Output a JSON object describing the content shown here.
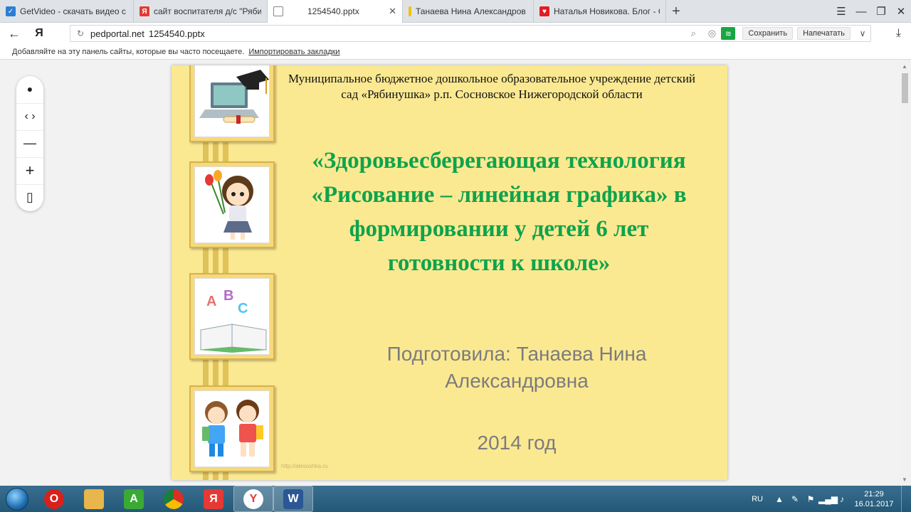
{
  "browser": {
    "tabs": [
      {
        "label": "GetVideo - скачать видео с",
        "color": "#2a7fd4",
        "glyph": "✓"
      },
      {
        "label": "сайт воспитателя д/с \"Рябин",
        "color": "#e53935",
        "glyph": "Я"
      },
      {
        "label": "1254540.pptx",
        "color": "#ffffff",
        "glyph": ""
      },
      {
        "label": "Танаева Нина Александров",
        "color": "#f3c200",
        "glyph": "ı"
      },
      {
        "label": "Наталья Новикова. Блог - С",
        "color": "#e31b23",
        "glyph": "♥"
      }
    ],
    "close_glyph": "✕",
    "new_tab_glyph": "+",
    "window_controls": [
      "☰",
      "—",
      "❐",
      "✕"
    ],
    "back_glyph": "←",
    "yandex_glyph": "Я",
    "address": {
      "domain": "pedportal.net",
      "path": "1254540.pptx"
    },
    "save_label": "Сохранить",
    "print_label": "Напечатать",
    "download_glyph": "⤓",
    "bookmarks_hint": "Добавляйте на эту панель сайты, которые вы часто посещаете.",
    "import_label": "Импортировать закладки"
  },
  "viewer": {
    "controls": [
      "●",
      "‹ ›",
      "—",
      "+",
      "▯"
    ]
  },
  "slide": {
    "org": "Муниципальное бюджетное дошкольное образовательное учреждение детский сад «Рябинушка» р.п. Сосновское Нижегородской области",
    "title": "«Здоровьесберегающая технология «Рисование – линейная графика» в формировании у детей 6 лет готовности к школе»",
    "author": "Подготовила: Танаева Нина Александровна",
    "year": "2014 год",
    "watermark": "http://alesoshka.ru",
    "abc_letters": [
      "A",
      "B",
      "C"
    ]
  },
  "taskbar": {
    "apps": [
      {
        "name": "opera",
        "color": "#d9211b",
        "glyph": "O"
      },
      {
        "name": "explorer",
        "color": "#e8b64a",
        "glyph": ""
      },
      {
        "name": "apteka",
        "color": "#3aa935",
        "glyph": "A"
      },
      {
        "name": "chrome",
        "color": "#d93025",
        "glyph": "●"
      },
      {
        "name": "yandex",
        "color": "#e53935",
        "glyph": "Я"
      },
      {
        "name": "yandex-browser",
        "color": "#ffffff",
        "glyph": "Y"
      },
      {
        "name": "word",
        "color": "#2b5797",
        "glyph": "W"
      }
    ],
    "lang": "RU",
    "time": "21:29",
    "date": "16.01.2017"
  }
}
